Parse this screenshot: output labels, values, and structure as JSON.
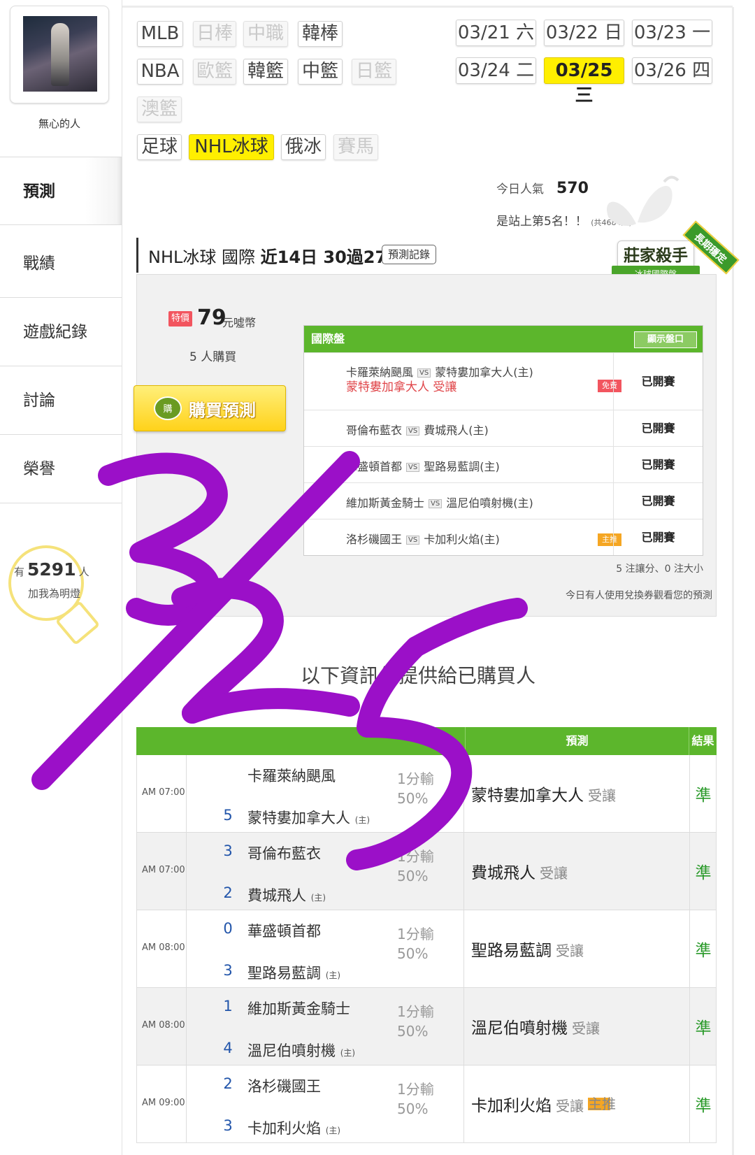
{
  "profile": {
    "name": "無心的人"
  },
  "nav": [
    {
      "label": "預測",
      "active": true
    },
    {
      "label": "戰績"
    },
    {
      "label": "遊戲紀錄"
    },
    {
      "label": "討論"
    },
    {
      "label": "榮譽"
    }
  ],
  "fans": {
    "prefix": "有",
    "count": "5291",
    "unit": "人",
    "action": "加我為明燈"
  },
  "sport_tabs": [
    {
      "label": "MLB",
      "state": "normal"
    },
    {
      "label": "日棒",
      "state": "disabled"
    },
    {
      "label": "中職",
      "state": "disabled"
    },
    {
      "label": "韓棒",
      "state": "normal"
    },
    {
      "label": "NBA",
      "state": "normal"
    },
    {
      "label": "歐籃",
      "state": "disabled"
    },
    {
      "label": "韓籃",
      "state": "normal"
    },
    {
      "label": "中籃",
      "state": "normal"
    },
    {
      "label": "日籃",
      "state": "disabled"
    },
    {
      "label": "澳籃",
      "state": "disabled"
    },
    {
      "label": "足球",
      "state": "normal"
    },
    {
      "label": "NHL冰球",
      "state": "selected"
    },
    {
      "label": "俄冰",
      "state": "normal"
    },
    {
      "label": "賽馬",
      "state": "disabled"
    }
  ],
  "dates": [
    {
      "label": "03/21 六"
    },
    {
      "label": "03/22 日"
    },
    {
      "label": "03/23 一"
    },
    {
      "label": "03/24 二"
    },
    {
      "label": "03/25 三",
      "selected": true
    },
    {
      "label": "03/26 四"
    }
  ],
  "popularity": {
    "label": "今日人氣",
    "value": "570",
    "rank_text": "是站上第5名！！",
    "total": "(共4684人)"
  },
  "header": {
    "prefix": "NHL冰球 國際",
    "record": "近14日 30過27",
    "history_button": "預測記錄"
  },
  "badge": {
    "title": "莊家殺手",
    "sub": "冰球國際盤",
    "seal": "長期穩定"
  },
  "offer": {
    "tag": "特價",
    "price": "79",
    "unit": "元噓幣",
    "buyers": "5 人購買",
    "buy_button": "購買預測",
    "buy_icon": "購"
  },
  "games_box": {
    "title": "國際盤",
    "show_odds_button": "顯示盤口",
    "vs": "VS",
    "rows": [
      {
        "away": "卡羅萊納颶風",
        "home": "蒙特婁加拿大人(主)",
        "pick": "蒙特婁加拿大人  受讓",
        "tag": "免費",
        "status": "已開賽"
      },
      {
        "away": "哥倫布藍衣",
        "home": "費城飛人(主)",
        "status": "已開賽"
      },
      {
        "away": "華盛頓首都",
        "home": "聖路易藍調(主)",
        "status": "已開賽"
      },
      {
        "away": "維加斯黃金騎士",
        "home": "溫尼伯噴射機(主)",
        "status": "已開賽"
      },
      {
        "away": "洛杉磯國王",
        "home": "卡加利火焰(主)",
        "tag": "主推",
        "status": "已開賽"
      }
    ],
    "summary": "5 注讓分、0 注大小",
    "note": "今日有人使用兌換券觀看您的預測"
  },
  "info_text": "以下資訊僅提供給已購買人",
  "results": {
    "headers": [
      "預測",
      "結果"
    ],
    "home_mark": "(主)",
    "rows": [
      {
        "time": "AM 07:00",
        "away_score": "",
        "away": "卡羅萊納颶風",
        "home_score": "5",
        "home": "蒙特婁加拿大人",
        "line1": "1分輸",
        "line2": "50%",
        "pick": "蒙特婁加拿大人",
        "pick_type": "受讓",
        "result": "準"
      },
      {
        "time": "AM 07:00",
        "away_score": "3",
        "away": "哥倫布藍衣",
        "home_score": "2",
        "home": "費城飛人",
        "line1": "1分輸",
        "line2": "50%",
        "pick": "費城飛人",
        "pick_type": "受讓",
        "result": "準"
      },
      {
        "time": "AM 08:00",
        "away_score": "0",
        "away": "華盛頓首都",
        "home_score": "3",
        "home": "聖路易藍調",
        "line1": "1分輸",
        "line2": "50%",
        "pick": "聖路易藍調",
        "pick_type": "受讓",
        "result": "準"
      },
      {
        "time": "AM 08:00",
        "away_score": "1",
        "away": "維加斯黃金騎士",
        "home_score": "4",
        "home": "溫尼伯噴射機",
        "line1": "1分輸",
        "line2": "50%",
        "pick": "溫尼伯噴射機",
        "pick_type": "受讓",
        "result": "準"
      },
      {
        "time": "AM 09:00",
        "away_score": "2",
        "away": "洛杉磯國王",
        "home_score": "3",
        "home": "卡加利火焰",
        "line1": "1分輸",
        "line2": "50%",
        "pick": "卡加利火焰",
        "pick_type": "受讓",
        "tag": "主推",
        "result": "準"
      }
    ]
  },
  "handwriting": {
    "text": "3/25",
    "color": "#9b10c8"
  }
}
